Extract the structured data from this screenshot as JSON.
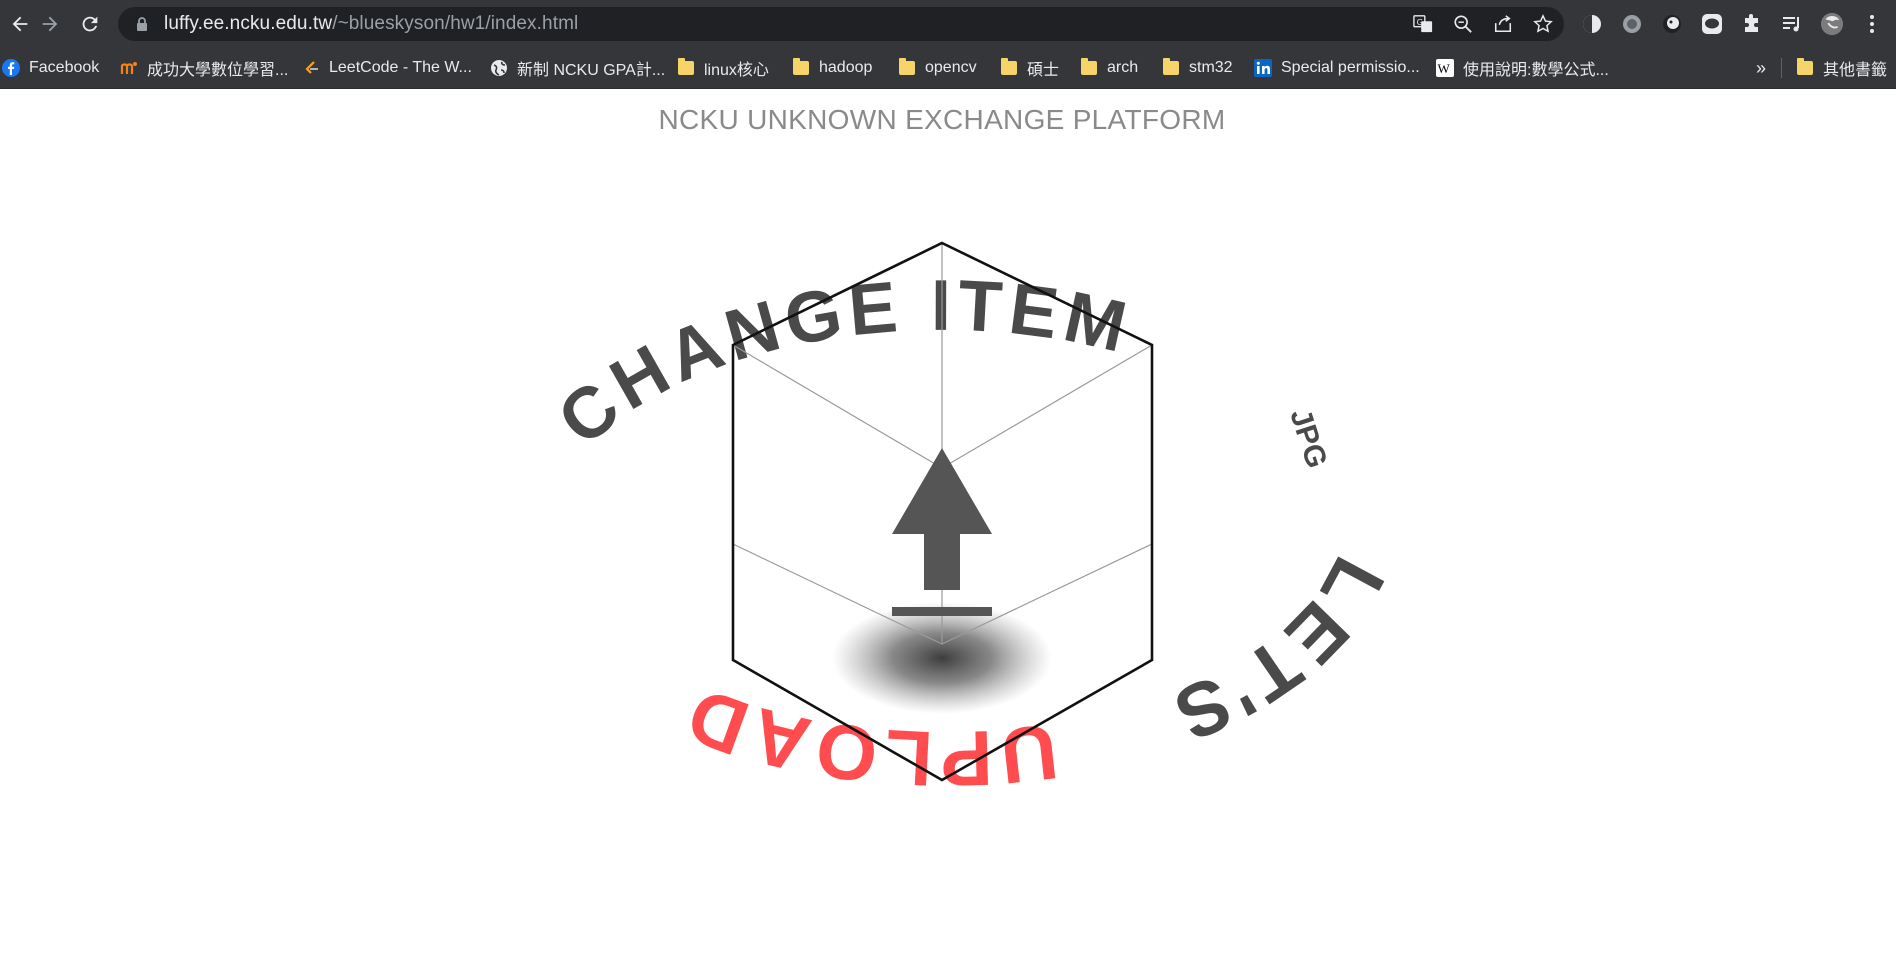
{
  "browser": {
    "url_host": "luffy.ee.ncku.edu.tw",
    "url_path": "/~blueskyson/hw1/index.html",
    "icons": [
      "back-icon",
      "forward-icon",
      "reload-icon",
      "lock-icon",
      "translate-icon",
      "zoom-icon",
      "share-icon",
      "star-icon",
      "puzzle-icon",
      "media-icon",
      "profile-avatar",
      "menu-icon"
    ]
  },
  "bookmarks": [
    {
      "label": "Facebook",
      "icon": "facebook-icon"
    },
    {
      "label": "成功大學數位學習...",
      "icon": "moodle-icon"
    },
    {
      "label": "LeetCode - The W...",
      "icon": "leetcode-icon"
    },
    {
      "label": "新制 NCKU GPA計...",
      "icon": "globe-icon"
    },
    {
      "label": "linux核心",
      "icon": "folder-icon"
    },
    {
      "label": "hadoop",
      "icon": "folder-icon"
    },
    {
      "label": "opencv",
      "icon": "folder-icon"
    },
    {
      "label": "碩士",
      "icon": "folder-icon"
    },
    {
      "label": "arch",
      "icon": "folder-icon"
    },
    {
      "label": "stm32",
      "icon": "folder-icon"
    },
    {
      "label": "Special permissio...",
      "icon": "linkedin-icon"
    },
    {
      "label": "使用說明:數學公式...",
      "icon": "wikipedia-icon"
    }
  ],
  "bookmarks_more": "»",
  "other_bookmarks": "其他書籤",
  "page": {
    "title": "NCKU UNKNOWN EXCHANGE PLATFORM",
    "ring_text_dark": "CHANGE ITEM",
    "ring_text_right": "JPG",
    "ring_text_right2": "LET'S",
    "ring_text_red": "UPLOAD",
    "colors": {
      "accent_red": "#ff4d4f",
      "text_dark": "#4a4a4a",
      "cube_line": "#000000"
    }
  }
}
